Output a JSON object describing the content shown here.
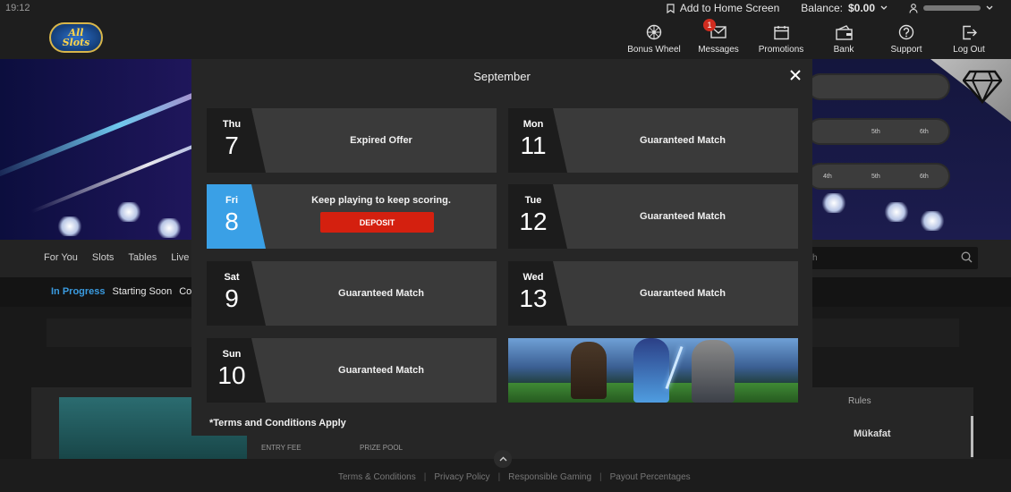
{
  "status": {
    "time": "19:12"
  },
  "top_links": {
    "add_home": "Add to Home Screen",
    "balance_label": "Balance:",
    "balance_value": "$0.00"
  },
  "logo_text": "All Slots",
  "nav": [
    {
      "label": "Bonus Wheel",
      "icon": "wheel-icon"
    },
    {
      "label": "Messages",
      "icon": "envelope-icon",
      "badge": "1"
    },
    {
      "label": "Promotions",
      "icon": "calendar-icon"
    },
    {
      "label": "Bank",
      "icon": "wallet-icon"
    },
    {
      "label": "Support",
      "icon": "help-icon"
    },
    {
      "label": "Log Out",
      "icon": "logout-icon"
    }
  ],
  "categories": [
    "For You",
    "Slots",
    "Tables",
    "Live"
  ],
  "search_placeholder": "ch",
  "subtabs": [
    "In Progress",
    "Starting Soon",
    "Co"
  ],
  "hero_pills": [
    "4th",
    "5th",
    "6th",
    "5th",
    "6th"
  ],
  "tournament": {
    "entry_fee_label": "ENTRY FEE",
    "prize_pool_label": "PRIZE POOL",
    "rules_label": "Rules",
    "reward_label": "Mükafat"
  },
  "footer_links": [
    "Terms & Conditions",
    "Privacy Policy",
    "Responsible Gaming",
    "Payout Percentages"
  ],
  "modal": {
    "title": "September",
    "terms": "*Terms and Conditions Apply",
    "deposit_label": "DEPOSIT",
    "days": [
      {
        "dow": "Thu",
        "num": "7",
        "label": "Expired Offer"
      },
      {
        "dow": "Fri",
        "num": "8",
        "label": "Keep playing to keep scoring."
      },
      {
        "dow": "Sat",
        "num": "9",
        "label": "Guaranteed Match"
      },
      {
        "dow": "Sun",
        "num": "10",
        "label": "Guaranteed Match"
      },
      {
        "dow": "Mon",
        "num": "11",
        "label": "Guaranteed Match"
      },
      {
        "dow": "Tue",
        "num": "12",
        "label": "Guaranteed Match"
      },
      {
        "dow": "Wed",
        "num": "13",
        "label": "Guaranteed Match"
      }
    ]
  },
  "colors": {
    "accent_blue": "#3aa0e6",
    "deposit_red": "#d4200f",
    "modal_bg": "#262626"
  }
}
